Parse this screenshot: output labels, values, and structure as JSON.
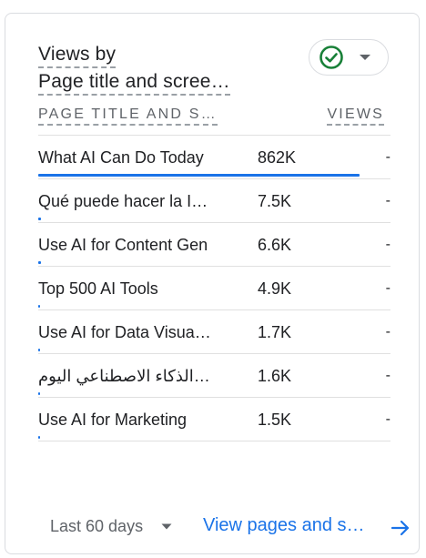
{
  "card": {
    "title_line1": "Views by",
    "title_line2": "Page title and scree…",
    "column_left": "PAGE TITLE AND S…",
    "column_right": "VIEWS",
    "status_icon": "check-circle-icon",
    "accent_color": "#1a73e8",
    "status_color": "#188038"
  },
  "rows": [
    {
      "label": "What AI Can Do Today",
      "value": "862K",
      "trend": "-",
      "bar_fraction": 1.0
    },
    {
      "label": "Qué puede hacer la I…",
      "value": "7.5K",
      "trend": "-",
      "bar_fraction": 0.009
    },
    {
      "label": "Use AI for Content Gen",
      "value": "6.6K",
      "trend": "-",
      "bar_fraction": 0.008
    },
    {
      "label": "Top 500 AI Tools",
      "value": "4.9K",
      "trend": "-",
      "bar_fraction": 0.006
    },
    {
      "label": "Use AI for Data Visua…",
      "value": "1.7K",
      "trend": "-",
      "bar_fraction": 0.002
    },
    {
      "label": "…الذكاء الاصطناعي اليوم",
      "value": "1.6K",
      "trend": "-",
      "bar_fraction": 0.002
    },
    {
      "label": "Use AI for Marketing",
      "value": "1.5K",
      "trend": "-",
      "bar_fraction": 0.002
    }
  ],
  "footer": {
    "date_range": "Last 60 days",
    "link_label": "View pages and s…"
  }
}
